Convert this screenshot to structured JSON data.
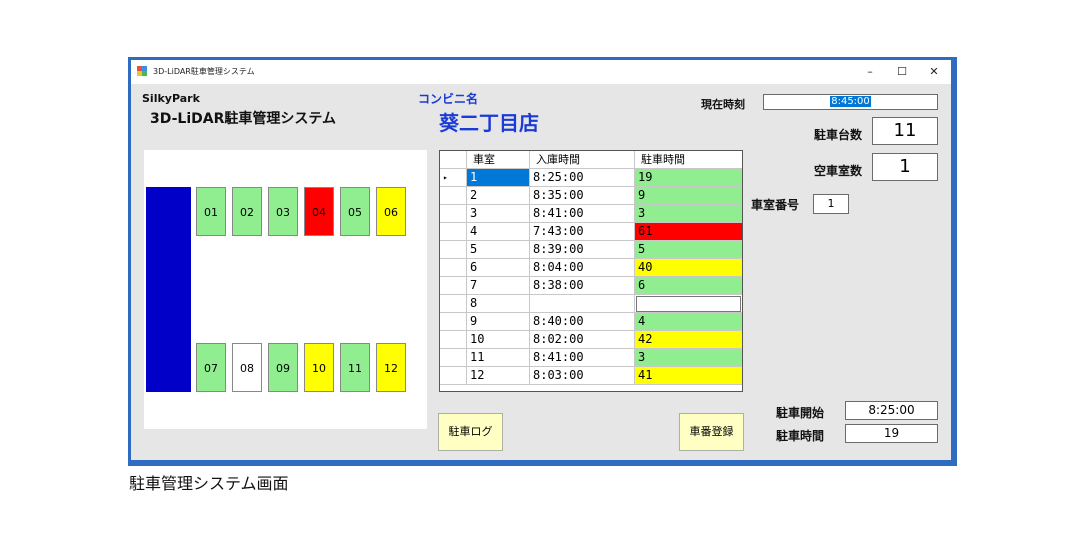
{
  "window": {
    "title": "3D-LiDAR駐車管理システム",
    "minimize": "–",
    "maximize": "☐",
    "close": "✕"
  },
  "header": {
    "brand": "SilkyPark",
    "system_name": "3D-LiDAR駐車管理システム",
    "store_label": "コンビニ名",
    "store_name": "葵二丁目店"
  },
  "clock": {
    "label": "現在時刻",
    "value": "8:45:00"
  },
  "stats": {
    "parked_label": "駐車台数",
    "parked_value": "11",
    "empty_label": "空車室数",
    "empty_value": "1",
    "room_label": "車室番号",
    "room_value": "1",
    "start_label": "駐車開始",
    "start_value": "8:25:00",
    "duration_label": "駐車時間",
    "duration_value": "19"
  },
  "lot": {
    "top_row": [
      {
        "label": "01",
        "status": "green"
      },
      {
        "label": "02",
        "status": "green"
      },
      {
        "label": "03",
        "status": "green"
      },
      {
        "label": "04",
        "status": "red"
      },
      {
        "label": "05",
        "status": "green"
      },
      {
        "label": "06",
        "status": "yellow"
      }
    ],
    "bottom_row": [
      {
        "label": "07",
        "status": "green"
      },
      {
        "label": "08",
        "status": "empty"
      },
      {
        "label": "09",
        "status": "green"
      },
      {
        "label": "10",
        "status": "yellow"
      },
      {
        "label": "11",
        "status": "green"
      },
      {
        "label": "12",
        "status": "yellow"
      }
    ]
  },
  "table": {
    "columns": [
      "車室",
      "入庫時間",
      "駐車時間"
    ],
    "rows": [
      {
        "room": "1",
        "entry": "8:25:00",
        "duration": "19",
        "status": "green",
        "selected": true
      },
      {
        "room": "2",
        "entry": "8:35:00",
        "duration": "9",
        "status": "green",
        "selected": false
      },
      {
        "room": "3",
        "entry": "8:41:00",
        "duration": "3",
        "status": "green",
        "selected": false
      },
      {
        "room": "4",
        "entry": "7:43:00",
        "duration": "61",
        "status": "red",
        "selected": false
      },
      {
        "room": "5",
        "entry": "8:39:00",
        "duration": "5",
        "status": "green",
        "selected": false
      },
      {
        "room": "6",
        "entry": "8:04:00",
        "duration": "40",
        "status": "yellow",
        "selected": false
      },
      {
        "room": "7",
        "entry": "8:38:00",
        "duration": "6",
        "status": "green",
        "selected": false
      },
      {
        "room": "8",
        "entry": "",
        "duration": "",
        "status": "empty",
        "selected": false
      },
      {
        "room": "9",
        "entry": "8:40:00",
        "duration": "4",
        "status": "green",
        "selected": false
      },
      {
        "room": "10",
        "entry": "8:02:00",
        "duration": "42",
        "status": "yellow",
        "selected": false
      },
      {
        "room": "11",
        "entry": "8:41:00",
        "duration": "3",
        "status": "green",
        "selected": false
      },
      {
        "room": "12",
        "entry": "8:03:00",
        "duration": "41",
        "status": "yellow",
        "selected": false
      }
    ]
  },
  "buttons": {
    "log": "駐車ログ",
    "register": "車番登録"
  },
  "caption": "駐車管理システム画面",
  "colors": {
    "green": "#90ee90",
    "yellow": "#ffff00",
    "red": "#ff0000",
    "empty": "#ffffff",
    "lane": "#0000c8",
    "selected": "#0078d7",
    "accent_blue": "#1a3bd6",
    "frame": "#2f6cc1"
  }
}
